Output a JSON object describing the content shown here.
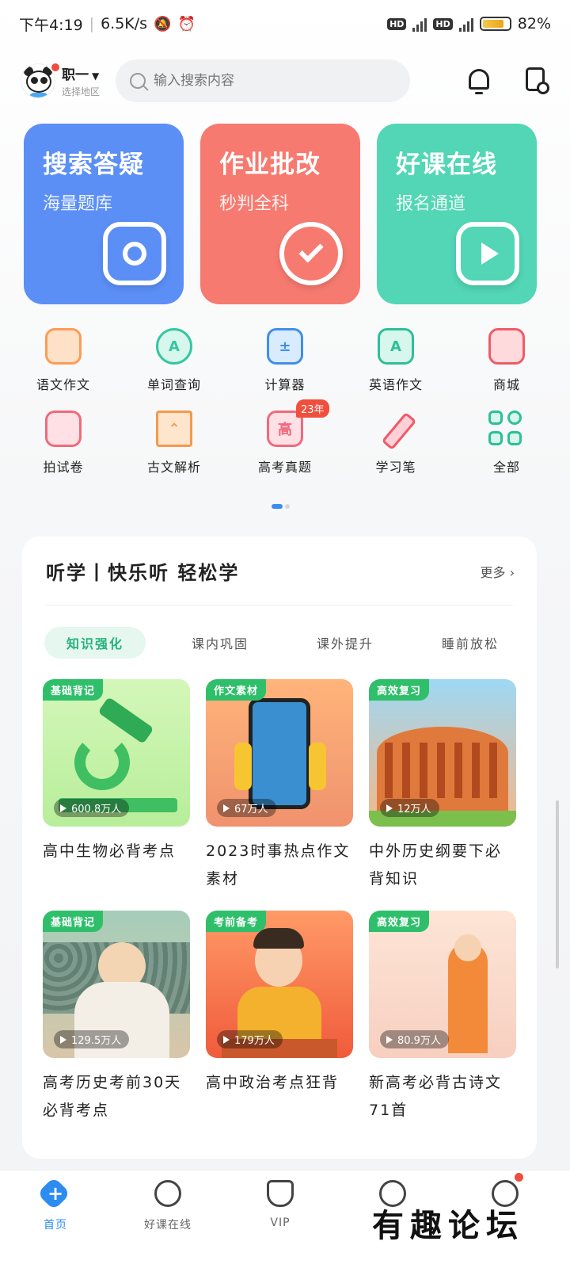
{
  "status_bar": {
    "time": "下午4:19",
    "net_speed": "6.5K/s",
    "hd1": "HD",
    "hd2": "HD",
    "battery": "82%",
    "battery_level": 0.82
  },
  "header": {
    "grade": "职一",
    "region": "选择地区",
    "search_placeholder": "输入搜索内容"
  },
  "feature_cards": [
    {
      "title": "搜索答疑",
      "subtitle": "海量题库",
      "icon": "camera-icon",
      "color": "#5b8ff6"
    },
    {
      "title": "作业批改",
      "subtitle": "秒判全科",
      "icon": "check-icon",
      "color": "#f77a70"
    },
    {
      "title": "好课在线",
      "subtitle": "报名通道",
      "icon": "play-icon",
      "color": "#52d6b5"
    }
  ],
  "tools": [
    {
      "label": "语文作文",
      "icon": "chinese-essay-icon"
    },
    {
      "label": "单词查询",
      "icon": "word-search-icon"
    },
    {
      "label": "计算器",
      "icon": "calculator-icon"
    },
    {
      "label": "英语作文",
      "icon": "english-essay-icon"
    },
    {
      "label": "商城",
      "icon": "store-icon"
    },
    {
      "label": "拍试卷",
      "icon": "scan-paper-icon"
    },
    {
      "label": "古文解析",
      "icon": "classical-text-icon"
    },
    {
      "label": "高考真题",
      "icon": "gaokao-icon",
      "badge": "23年"
    },
    {
      "label": "学习笔",
      "icon": "pen-icon"
    },
    {
      "label": "全部",
      "icon": "all-apps-icon"
    }
  ],
  "listen": {
    "title": "听学丨快乐听 轻松学",
    "more": "更多",
    "tabs": [
      "知识强化",
      "课内巩固",
      "课外提升",
      "睡前放松"
    ],
    "active_tab": 0,
    "items": [
      {
        "tag": "基础背记",
        "plays": "600.8万人",
        "title": "高中生物必背考点"
      },
      {
        "tag": "作文素材",
        "plays": "67万人",
        "title": "2023时事热点作文素材"
      },
      {
        "tag": "高效复习",
        "plays": "12万人",
        "title": "中外历史纲要下必背知识"
      },
      {
        "tag": "基础背记",
        "plays": "129.5万人",
        "title": "高考历史考前30天必背考点"
      },
      {
        "tag": "考前备考",
        "plays": "179万人",
        "title": "高中政治考点狂背"
      },
      {
        "tag": "高效复习",
        "plays": "80.9万人",
        "title": "新高考必背古诗文71首"
      }
    ]
  },
  "bottom_nav": {
    "items": [
      {
        "label": "首页",
        "icon": "home-icon",
        "active": true
      },
      {
        "label": "好课在线",
        "icon": "play-circle-icon"
      },
      {
        "label": "VIP",
        "icon": "vip-icon"
      },
      {
        "label": "",
        "icon": "back-icon"
      },
      {
        "label": "",
        "icon": "mine-icon"
      }
    ]
  },
  "watermark": "有趣论坛"
}
